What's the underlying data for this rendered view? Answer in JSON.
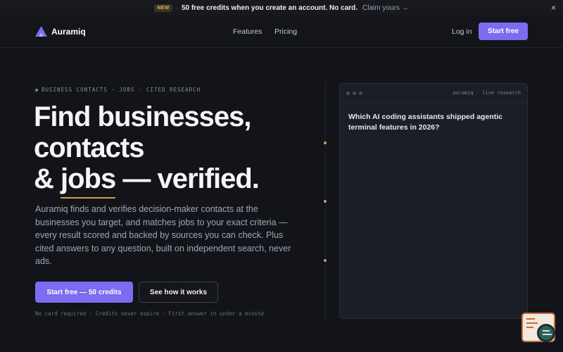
{
  "announce": {
    "badge": "NEW",
    "separator": "·",
    "text": "50 free credits when you create an account. No card.",
    "link": "Claim yours →",
    "close": "×"
  },
  "nav": {
    "brand": "Auramiq",
    "features": "Features",
    "pricing": "Pricing",
    "login": "Log in",
    "cta": "Start free"
  },
  "hero": {
    "eyebrow": "BUSINESS CONTACTS · JOBS · CITED RESEARCH",
    "headline_line1": "Find businesses,",
    "headline_line2": "contacts",
    "headline_line3_prefix": "& ",
    "headline_line3_jobs": "jobs",
    "headline_line3_suffix": " — verified.",
    "lede": "Auramiq finds and verifies decision-maker contacts at the businesses you target, and matches jobs to your exact criteria — every result scored and backed by sources you can check. Plus cited answers to any question, built on independent search, never ads.",
    "cta_primary": "Start free — 50 credits",
    "cta_secondary": "See how it works",
    "fineprint": "No card required · Credits never expire · First answer in under a minute"
  },
  "panel": {
    "label": "auramiq · live research",
    "question": "Which AI coding assistants shipped agentic terminal features in 2026?"
  },
  "colors": {
    "accent": "#7b6cf0",
    "gold": "#c8a34e",
    "background": "#12141a",
    "status_dot": "#37b27b"
  }
}
